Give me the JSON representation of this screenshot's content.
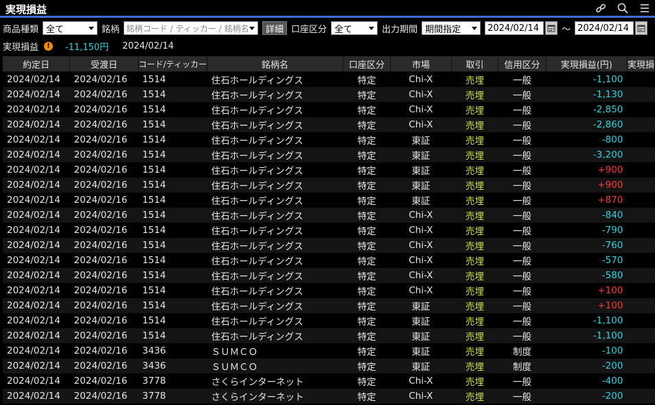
{
  "window": {
    "title": "実現損益"
  },
  "icons": [
    "link-icon",
    "search-icon",
    "menu-icon"
  ],
  "filters": {
    "product_type_label": "商品種類",
    "product_type_value": "全て",
    "symbol_label": "銘柄",
    "symbol_placeholder": "銘柄コード / ティッカー / 銘柄名",
    "detail_button": "詳細",
    "account_label": "口座区分",
    "account_value": "全て",
    "period_label": "出力期間",
    "period_value": "期間指定",
    "date_from": "2024/02/14",
    "tilde": "～",
    "date_to": "2024/02/14"
  },
  "summary": {
    "label": "実現損益",
    "value": "-11,150円",
    "date": "2024/02/14"
  },
  "colors": {
    "negative": "#2fd3e0",
    "positive": "#ff3a3a",
    "sell": "#c9e04a",
    "accent": "#3a6fd8"
  },
  "table": {
    "headers": [
      "約定日",
      "受渡日",
      "コード/ティッカー",
      "銘柄名",
      "口座区分",
      "市場",
      "取引",
      "信用区分",
      "実現損益(円)",
      "実現損"
    ],
    "rows": [
      [
        "2024/02/14",
        "2024/02/16",
        "1514",
        "住石ホールディングス",
        "特定",
        "Chi-X",
        "売埋",
        "一般",
        "-1,100"
      ],
      [
        "2024/02/14",
        "2024/02/16",
        "1514",
        "住石ホールディングス",
        "特定",
        "Chi-X",
        "売埋",
        "一般",
        "-1,130"
      ],
      [
        "2024/02/14",
        "2024/02/16",
        "1514",
        "住石ホールディングス",
        "特定",
        "Chi-X",
        "売埋",
        "一般",
        "-2,850"
      ],
      [
        "2024/02/14",
        "2024/02/16",
        "1514",
        "住石ホールディングス",
        "特定",
        "Chi-X",
        "売埋",
        "一般",
        "-2,860"
      ],
      [
        "2024/02/14",
        "2024/02/16",
        "1514",
        "住石ホールディングス",
        "特定",
        "東証",
        "売埋",
        "一般",
        "-800"
      ],
      [
        "2024/02/14",
        "2024/02/16",
        "1514",
        "住石ホールディングス",
        "特定",
        "東証",
        "売埋",
        "一般",
        "-3,200"
      ],
      [
        "2024/02/14",
        "2024/02/16",
        "1514",
        "住石ホールディングス",
        "特定",
        "東証",
        "売埋",
        "一般",
        "+900"
      ],
      [
        "2024/02/14",
        "2024/02/16",
        "1514",
        "住石ホールディングス",
        "特定",
        "東証",
        "売埋",
        "一般",
        "+900"
      ],
      [
        "2024/02/14",
        "2024/02/16",
        "1514",
        "住石ホールディングス",
        "特定",
        "東証",
        "売埋",
        "一般",
        "+870"
      ],
      [
        "2024/02/14",
        "2024/02/16",
        "1514",
        "住石ホールディングス",
        "特定",
        "Chi-X",
        "売埋",
        "一般",
        "-840"
      ],
      [
        "2024/02/14",
        "2024/02/16",
        "1514",
        "住石ホールディングス",
        "特定",
        "Chi-X",
        "売埋",
        "一般",
        "-790"
      ],
      [
        "2024/02/14",
        "2024/02/16",
        "1514",
        "住石ホールディングス",
        "特定",
        "Chi-X",
        "売埋",
        "一般",
        "-760"
      ],
      [
        "2024/02/14",
        "2024/02/16",
        "1514",
        "住石ホールディングス",
        "特定",
        "Chi-X",
        "売埋",
        "一般",
        "-570"
      ],
      [
        "2024/02/14",
        "2024/02/16",
        "1514",
        "住石ホールディングス",
        "特定",
        "Chi-X",
        "売埋",
        "一般",
        "-580"
      ],
      [
        "2024/02/14",
        "2024/02/16",
        "1514",
        "住石ホールディングス",
        "特定",
        "Chi-X",
        "売埋",
        "一般",
        "+100"
      ],
      [
        "2024/02/14",
        "2024/02/16",
        "1514",
        "住石ホールディングス",
        "特定",
        "東証",
        "売埋",
        "一般",
        "+100"
      ],
      [
        "2024/02/14",
        "2024/02/16",
        "1514",
        "住石ホールディングス",
        "特定",
        "東証",
        "売埋",
        "一般",
        "-1,100"
      ],
      [
        "2024/02/14",
        "2024/02/16",
        "1514",
        "住石ホールディングス",
        "特定",
        "東証",
        "売埋",
        "一般",
        "-1,100"
      ],
      [
        "2024/02/14",
        "2024/02/16",
        "3436",
        "ＳＵＭＣＯ",
        "特定",
        "東証",
        "売埋",
        "制度",
        "-100"
      ],
      [
        "2024/02/14",
        "2024/02/16",
        "3436",
        "ＳＵＭＣＯ",
        "特定",
        "東証",
        "売埋",
        "制度",
        "-200"
      ],
      [
        "2024/02/14",
        "2024/02/16",
        "3778",
        "さくらインターネット",
        "特定",
        "Chi-X",
        "売埋",
        "一般",
        "-400"
      ],
      [
        "2024/02/14",
        "2024/02/16",
        "3778",
        "さくらインターネット",
        "特定",
        "Chi-X",
        "売埋",
        "一般",
        "-200"
      ]
    ]
  }
}
